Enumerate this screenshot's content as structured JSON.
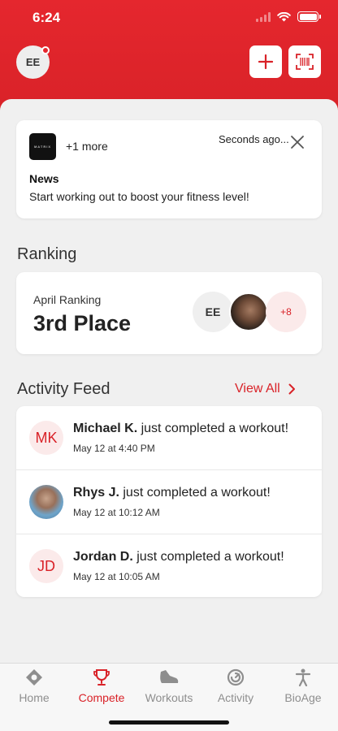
{
  "status_bar": {
    "time": "6:24"
  },
  "header": {
    "avatar_initials": "EE"
  },
  "news": {
    "logo_text": "MATRIX",
    "more": "+1 more",
    "timestamp": "Seconds ago...",
    "title": "News",
    "body": "Start working out to boost your fitness level!"
  },
  "ranking": {
    "section_title": "Ranking",
    "label": "April Ranking",
    "value": "3rd Place",
    "avatar_initials": "EE",
    "more_count": "+8"
  },
  "activity_feed": {
    "section_title": "Activity Feed",
    "view_all": "View All",
    "items": [
      {
        "initials": "MK",
        "name": "Michael K.",
        "action": " just completed a workout!",
        "date": "May 12 at 4:40 PM"
      },
      {
        "initials": "",
        "name": "Rhys J.",
        "action": " just completed a workout!",
        "date": "May 12 at 10:12 AM"
      },
      {
        "initials": "JD",
        "name": "Jordan D.",
        "action": " just completed a workout!",
        "date": "May 12 at 10:05 AM"
      }
    ]
  },
  "tabs": [
    {
      "label": "Home",
      "icon": "home-icon"
    },
    {
      "label": "Compete",
      "icon": "trophy-icon",
      "active": true
    },
    {
      "label": "Workouts",
      "icon": "shoe-icon"
    },
    {
      "label": "Activity",
      "icon": "activity-ring-icon"
    },
    {
      "label": "BioAge",
      "icon": "person-icon"
    }
  ],
  "colors": {
    "accent": "#d92228",
    "header_bg": "#e5272e",
    "background": "#f0f0f0"
  }
}
